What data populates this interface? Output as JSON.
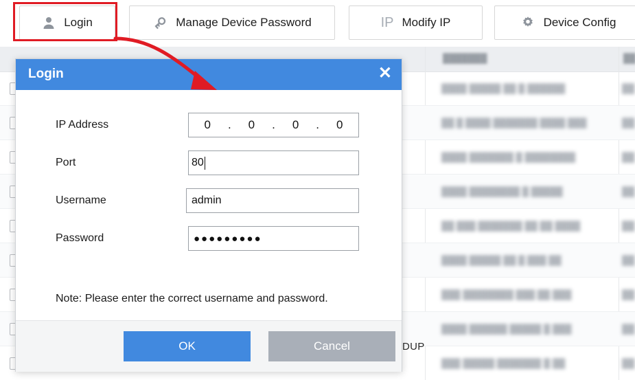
{
  "toolbar": {
    "buttons": [
      {
        "id": "login",
        "label": "Login",
        "icon": "user-icon",
        "highlighted": true
      },
      {
        "id": "manage",
        "label": "Manage Device Password",
        "icon": "key-icon",
        "highlighted": false
      },
      {
        "id": "modify-ip",
        "label": "Modify IP",
        "icon": "ip-icon",
        "highlighted": false
      },
      {
        "id": "device-config",
        "label": "Device Config",
        "icon": "gear-icon",
        "highlighted": false
      }
    ],
    "ip_icon_text": "IP"
  },
  "annotation": {
    "highlight_color": "#e01b24",
    "arrow_color": "#e01b24",
    "target": "login-button"
  },
  "dialog": {
    "title": "Login",
    "close_label": "✕",
    "title_bar_color": "#4189df",
    "fields": [
      {
        "name": "ip-address",
        "label": "IP Address",
        "type": "ip",
        "value": "0.0.0.0",
        "segments": [
          "0",
          "0",
          "0",
          "0"
        ],
        "separator": "."
      },
      {
        "name": "port",
        "label": "Port",
        "type": "text",
        "value": "80",
        "focused": true
      },
      {
        "name": "username",
        "label": "Username",
        "type": "text",
        "value": "admin",
        "focused": false
      },
      {
        "name": "password",
        "label": "Password",
        "type": "password",
        "value": "●●●●●●●●●",
        "focused": false
      }
    ],
    "note": "Note: Please enter the correct username and password.",
    "buttons": {
      "ok": {
        "label": "OK",
        "color": "#4189df"
      },
      "cancel": {
        "label": "Cancel",
        "color": "#a9afb8"
      }
    }
  },
  "background": {
    "description": "device list table (content blurred/redacted)",
    "partial_text": "DUP",
    "header_cells": [
      "███████",
      "██"
    ],
    "rows": [
      {
        "cells": [
          "████ █████ ██ █ ██████",
          "██"
        ]
      },
      {
        "cells": [
          "██ █ ████ ███████ ████ ███",
          "██"
        ]
      },
      {
        "cells": [
          "████ ███████ █ ████████",
          "██"
        ]
      },
      {
        "cells": [
          "████ ████████ █ █████",
          "██"
        ]
      },
      {
        "cells": [
          "██ ███ ███████ ██ ██ ████",
          "██"
        ]
      },
      {
        "cells": [
          "████ █████ ██ █ ███ ██",
          "██"
        ]
      },
      {
        "cells": [
          "███ ████████ ███ ██ ███",
          "██"
        ]
      },
      {
        "cells": [
          "████ ██████ █████ █ ███",
          "██"
        ]
      },
      {
        "cells": [
          "███ █████ ███████ █ ██",
          "██"
        ]
      }
    ]
  }
}
